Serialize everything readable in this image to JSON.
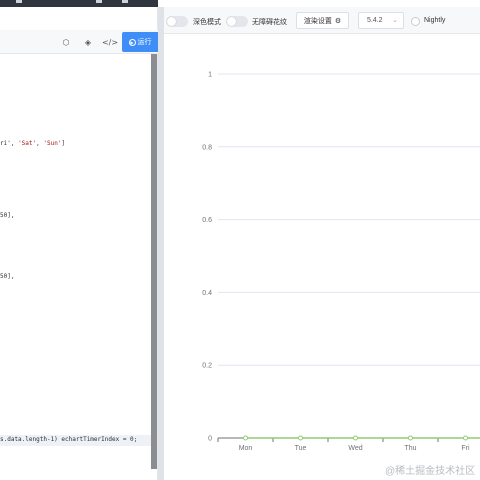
{
  "editor": {
    "toolbar_icons": [
      "codepen-icon",
      "cube-icon",
      "code-icon"
    ],
    "run_button_label": "运行",
    "code_lines": [
      {
        "text": "ri', ",
        "str1": "'Sat'",
        "sep": ", ",
        "str2": "'Sun'",
        "tail": "]"
      },
      {
        "text": "50],"
      },
      {
        "text": "50],"
      },
      {
        "text": "s.data.length-1) echartTimerIndex = 0;"
      }
    ]
  },
  "preview_toolbar": {
    "dark_mode_label": "深色模式",
    "accessibility_label": "无障碍花纹",
    "render_settings_label": "渲染设置",
    "version_value": "5.4.2",
    "nightly_label": "Nightly"
  },
  "chart_data": {
    "type": "line",
    "categories": [
      "Mon",
      "Tue",
      "Wed",
      "Thu",
      "Fri"
    ],
    "series": [
      {
        "values": [
          0,
          0,
          0,
          0,
          0
        ],
        "color": "#91cc75"
      }
    ],
    "ylim": [
      0,
      1
    ],
    "yticks": [
      "0",
      "0.2",
      "0.4",
      "0.6",
      "0.8",
      "1"
    ],
    "grid": true
  },
  "watermark": "@稀土掘金技术社区"
}
